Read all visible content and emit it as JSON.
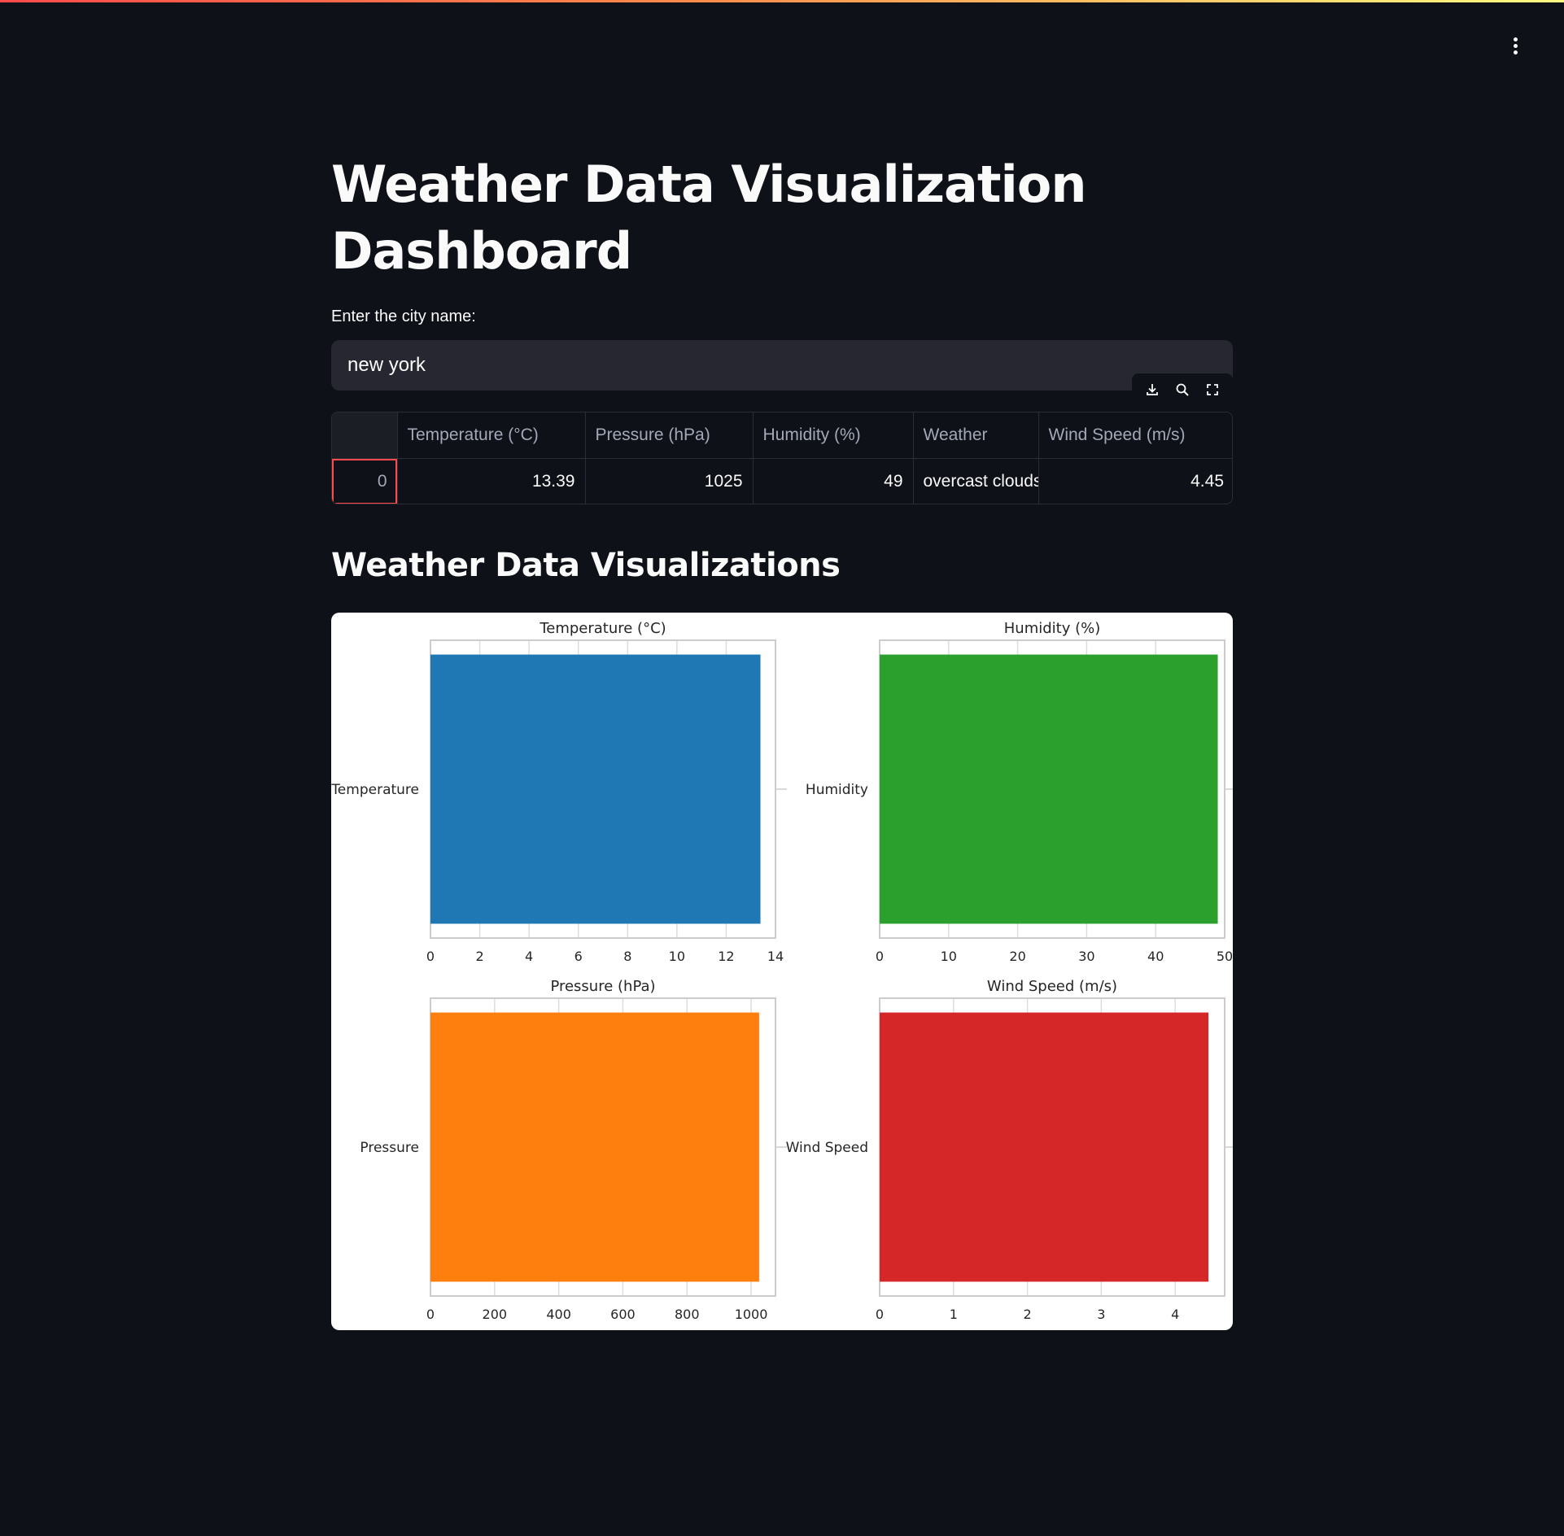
{
  "page": {
    "title": "Weather Data Visualization Dashboard",
    "menu_icon": "kebab-menu-icon"
  },
  "city": {
    "label": "Enter the city name:",
    "value": "new york"
  },
  "toolbar": {
    "icons": [
      "download-icon",
      "search-icon",
      "fullscreen-icon"
    ]
  },
  "table": {
    "columns": [
      "",
      "Temperature (°C)",
      "Pressure (hPa)",
      "Humidity (%)",
      "Weather",
      "Wind Speed (m/s)"
    ],
    "rows": [
      [
        "0",
        "13.39",
        "1025",
        "49",
        "overcast clouds",
        "4.45"
      ]
    ]
  },
  "section": {
    "title": "Weather Data Visualizations"
  },
  "chart_data": [
    {
      "type": "bar",
      "orientation": "horizontal",
      "title": "Temperature (°C)",
      "categories": [
        "Temperature"
      ],
      "values": [
        13.39
      ],
      "xlim": [
        0,
        14
      ],
      "xticks": [
        0,
        2,
        4,
        6,
        8,
        10,
        12,
        14
      ],
      "color": "#1f77b4"
    },
    {
      "type": "bar",
      "orientation": "horizontal",
      "title": "Humidity (%)",
      "categories": [
        "Humidity"
      ],
      "values": [
        49
      ],
      "xlim": [
        0,
        50
      ],
      "xticks": [
        0,
        10,
        20,
        30,
        40,
        50
      ],
      "color": "#2ca02c"
    },
    {
      "type": "bar",
      "orientation": "horizontal",
      "title": "Pressure (hPa)",
      "categories": [
        "Pressure"
      ],
      "values": [
        1025
      ],
      "xlim": [
        0,
        1076
      ],
      "xticks": [
        0,
        200,
        400,
        600,
        800,
        1000
      ],
      "color": "#ff7f0e"
    },
    {
      "type": "bar",
      "orientation": "horizontal",
      "title": "Wind Speed (m/s)",
      "categories": [
        "Wind Speed"
      ],
      "values": [
        4.45
      ],
      "xlim": [
        0,
        4.67
      ],
      "xticks": [
        0,
        1,
        2,
        3,
        4
      ],
      "color": "#d62728"
    }
  ]
}
